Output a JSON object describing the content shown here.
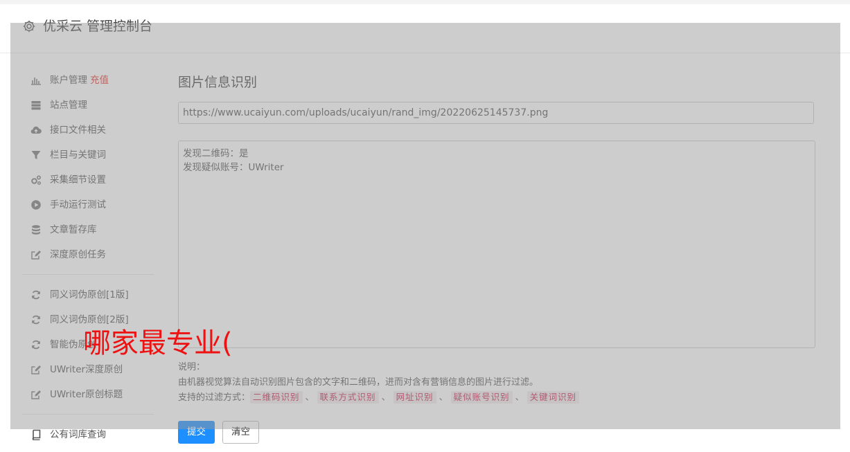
{
  "header": {
    "title": "优采云 管理控制台",
    "icon": "gear-icon"
  },
  "sidebar": {
    "groups": [
      [
        {
          "label": "账户管理",
          "badge": "充值",
          "icon": "bar-chart-icon"
        },
        {
          "label": "站点管理",
          "icon": "server-icon"
        },
        {
          "label": "接口文件相关",
          "icon": "cloud-upload-icon"
        },
        {
          "label": "栏目与关键词",
          "icon": "filter-icon"
        },
        {
          "label": "采集细节设置",
          "icon": "cogs-icon"
        },
        {
          "label": "手动运行测试",
          "icon": "play-circle-icon"
        },
        {
          "label": "文章暂存库",
          "icon": "database-icon"
        },
        {
          "label": "深度原创任务",
          "icon": "edit-icon"
        }
      ],
      [
        {
          "label": "同义词伪原创[1版]",
          "icon": "refresh-icon"
        },
        {
          "label": "同义词伪原创[2版]",
          "icon": "refresh-icon"
        },
        {
          "label": "智能伪原创",
          "icon": "refresh-icon"
        },
        {
          "label": "UWriter深度原创",
          "icon": "edit-icon"
        },
        {
          "label": "UWriter原创标题",
          "icon": "edit-icon"
        }
      ],
      [
        {
          "label": "公有词库查询",
          "icon": "book-icon"
        }
      ]
    ]
  },
  "main": {
    "title": "图片信息识别",
    "url_value": "https://www.ucaiyun.com/uploads/ucaiyun/rand_img/20220625145737.png",
    "result_lines": [
      "发现二维码：是",
      "发现疑似账号：UWriter"
    ],
    "help_title": "说明：",
    "help_desc": "由机器视觉算法自动识别图片包含的文字和二维码，进而对含有营销信息的图片进行过滤。",
    "filters_label": "支持的过滤方式：",
    "filters": [
      "二维码识别",
      "联系方式识别",
      "网址识别",
      "疑似账号识别",
      "关键词识别"
    ],
    "filter_separator": "、",
    "submit_label": "提交",
    "clear_label": "清空"
  },
  "overlay_text": "哪家最专业(",
  "colors": {
    "accent": "#1e8fff",
    "badge": "#e3322e",
    "tag_text": "#c7254e",
    "tag_bg": "#f3eaec",
    "watermark": "#ee1111"
  }
}
